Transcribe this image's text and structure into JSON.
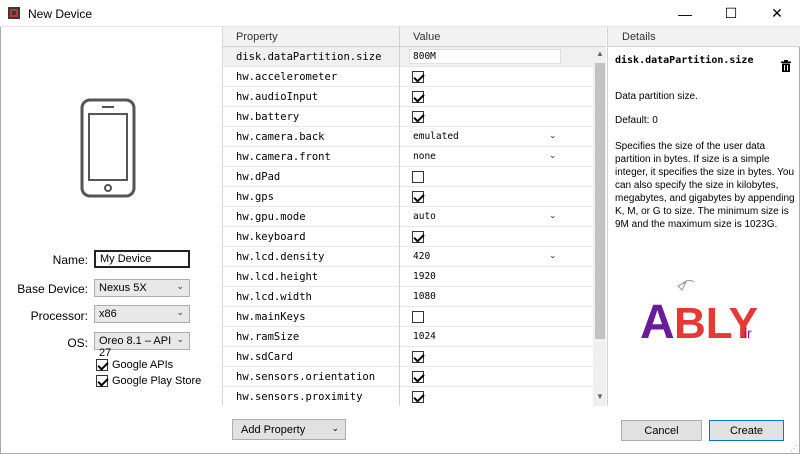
{
  "window": {
    "title": "New Device",
    "minimize": "—",
    "maximize": "☐",
    "close": "✕"
  },
  "form": {
    "name_label": "Name:",
    "name_value": "My Device",
    "base_device_label": "Base Device:",
    "base_device_value": "Nexus 5X",
    "processor_label": "Processor:",
    "processor_value": "x86",
    "os_label": "OS:",
    "os_value": "Oreo 8.1 – API 27",
    "google_apis_label": "Google APIs",
    "google_apis_checked": true,
    "play_store_label": "Google Play Store",
    "play_store_checked": true
  },
  "grid": {
    "header_property": "Property",
    "header_value": "Value",
    "rows": [
      {
        "name": "disk.dataPartition.size",
        "type": "text",
        "value": "800M",
        "selected": true
      },
      {
        "name": "hw.accelerometer",
        "type": "checkbox",
        "checked": true
      },
      {
        "name": "hw.audioInput",
        "type": "checkbox",
        "checked": true
      },
      {
        "name": "hw.battery",
        "type": "checkbox",
        "checked": true
      },
      {
        "name": "hw.camera.back",
        "type": "select",
        "value": "emulated"
      },
      {
        "name": "hw.camera.front",
        "type": "select",
        "value": "none"
      },
      {
        "name": "hw.dPad",
        "type": "checkbox",
        "checked": false
      },
      {
        "name": "hw.gps",
        "type": "checkbox",
        "checked": true
      },
      {
        "name": "hw.gpu.mode",
        "type": "select",
        "value": "auto"
      },
      {
        "name": "hw.keyboard",
        "type": "checkbox",
        "checked": true
      },
      {
        "name": "hw.lcd.density",
        "type": "select",
        "value": "420"
      },
      {
        "name": "hw.lcd.height",
        "type": "text",
        "value": "1920"
      },
      {
        "name": "hw.lcd.width",
        "type": "text",
        "value": "1080"
      },
      {
        "name": "hw.mainKeys",
        "type": "checkbox",
        "checked": false
      },
      {
        "name": "hw.ramSize",
        "type": "text",
        "value": "1024"
      },
      {
        "name": "hw.sdCard",
        "type": "checkbox",
        "checked": true
      },
      {
        "name": "hw.sensors.orientation",
        "type": "checkbox",
        "checked": true
      },
      {
        "name": "hw.sensors.proximity",
        "type": "checkbox",
        "checked": true
      }
    ]
  },
  "details": {
    "header": "Details",
    "title": "disk.dataPartition.size",
    "summary": "Data partition size.",
    "default": "Default: 0",
    "description": "Specifies the size of the user data partition in bytes. If size is a simple integer, it specifies the size in bytes. You can also specify the size in kilobytes, megabytes, and gigabytes by appending K, M, or G to size. The minimum size is 9M and the maximum size is 1023G."
  },
  "logo": {
    "text": "ABLY",
    "suffix": ".ir"
  },
  "buttons": {
    "add_property": "Add Property",
    "cancel": "Cancel",
    "create": "Create"
  },
  "colors": {
    "accent": "#0078d7",
    "logo_purple": "#6a1b9a",
    "logo_red": "#e53935"
  }
}
